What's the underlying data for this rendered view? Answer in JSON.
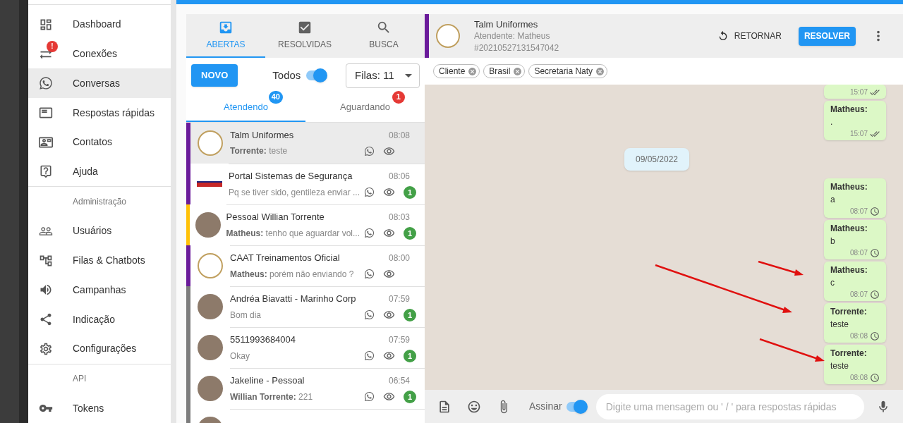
{
  "sidebar": {
    "items": [
      {
        "kind": "link",
        "label": "Dashboard",
        "selected": false
      },
      {
        "kind": "link",
        "label": "Conexões",
        "selected": false,
        "alert": "!"
      },
      {
        "kind": "link",
        "label": "Conversas",
        "selected": true
      },
      {
        "kind": "link",
        "label": "Respostas rápidas",
        "selected": false
      },
      {
        "kind": "link",
        "label": "Contatos",
        "selected": false
      },
      {
        "kind": "link",
        "label": "Ajuda",
        "selected": false
      },
      {
        "kind": "header",
        "label": "Administração"
      },
      {
        "kind": "link",
        "label": "Usuários",
        "selected": false
      },
      {
        "kind": "link",
        "label": "Filas & Chatbots",
        "selected": false
      },
      {
        "kind": "link",
        "label": "Campanhas",
        "selected": false
      },
      {
        "kind": "link",
        "label": "Indicação",
        "selected": false
      },
      {
        "kind": "link",
        "label": "Configurações",
        "selected": false
      },
      {
        "kind": "header",
        "label": "API"
      },
      {
        "kind": "link",
        "label": "Tokens",
        "selected": false
      }
    ]
  },
  "tickets": {
    "tabs": [
      {
        "label": "ABERTAS",
        "selected": true
      },
      {
        "label": "RESOLVIDAS",
        "selected": false
      },
      {
        "label": "BUSCA",
        "selected": false
      }
    ],
    "new_button": "NOVO",
    "show_all": {
      "label": "Todos",
      "on": true
    },
    "queue_select": {
      "value": "Filas: 11"
    },
    "subtabs": [
      {
        "label": "Atendendo",
        "badge": "40",
        "selected": true
      },
      {
        "label": "Aguardando",
        "badge": "1",
        "selected": false
      }
    ],
    "list": [
      {
        "kind": "logo",
        "name": "Talm Uniformes",
        "time": "08:08",
        "sender": "Torrente:",
        "message": "teste",
        "color": "#6a1b9a",
        "selected": true
      },
      {
        "kind": "banner",
        "name": "Portal Sistemas de Segurança",
        "time": "08:06",
        "message": "Pq se tiver sido, gentileza enviar ...",
        "unread": "1",
        "color": "#6a1b9a",
        "selected": false
      },
      {
        "kind": "photo",
        "name": "Pessoal Willian Torrente",
        "time": "08:03",
        "sender": "Matheus:",
        "message": "tenho que aguardar vol...",
        "unread": "1",
        "color": "#ffc107",
        "selected": false
      },
      {
        "kind": "logo",
        "name": "CAAT Treinamentos Oficial",
        "time": "08:00",
        "sender": "Matheus:",
        "message": "porém não enviando ?",
        "color": "#6a1b9a",
        "selected": false
      },
      {
        "kind": "photo",
        "name": "Andréa Biavatti - Marinho Corp",
        "time": "07:59",
        "message": "Bom dia",
        "unread": "1",
        "color": "#7c7c7c",
        "selected": false
      },
      {
        "kind": "photo",
        "name": "5511993684004",
        "time": "07:59",
        "message": "Okay",
        "unread": "1",
        "color": "#7c7c7c",
        "selected": false
      },
      {
        "kind": "photo",
        "name": "Jakeline - Pessoal",
        "time": "06:54",
        "sender": "Willian Torrente:",
        "message": "221",
        "unread": "1",
        "color": "#7c7c7c",
        "selected": false
      },
      {
        "kind": "photo",
        "color": "#7c7c7c",
        "selected": false
      }
    ]
  },
  "chat": {
    "header": {
      "name": "Talm Uniformes",
      "agent": "Atendente: Matheus",
      "ticket": "#20210527131547042",
      "color": "#6a1b9a",
      "return_button": "RETORNAR",
      "resolve_button": "RESOLVER"
    },
    "tags": [
      "Cliente",
      "Brasil",
      "Secretaria Naty"
    ],
    "messages": [
      {
        "kind": "bubble",
        "time": "15:07",
        "read": true
      },
      {
        "kind": "bubble",
        "sender": "Matheus:",
        "text": ".",
        "time": "15:07",
        "read": true
      },
      {
        "kind": "date",
        "text": "09/05/2022"
      },
      {
        "kind": "bubble",
        "sender": "Matheus:",
        "text": "a",
        "time": "08:07",
        "read": false
      },
      {
        "kind": "bubble",
        "sender": "Matheus:",
        "text": "b",
        "time": "08:07",
        "read": false
      },
      {
        "kind": "bubble",
        "sender": "Matheus:",
        "text": "c",
        "time": "08:07",
        "read": false
      },
      {
        "kind": "bubble",
        "sender": "Torrente:",
        "text": "teste",
        "time": "08:08",
        "read": false
      },
      {
        "kind": "bubble",
        "sender": "Torrente:",
        "text": "teste",
        "time": "08:08",
        "read": false
      }
    ],
    "composer": {
      "sign": {
        "label": "Assinar",
        "on": true
      },
      "placeholder": "Digite uma mensagem ou ' / ' para respostas rápidas"
    }
  }
}
